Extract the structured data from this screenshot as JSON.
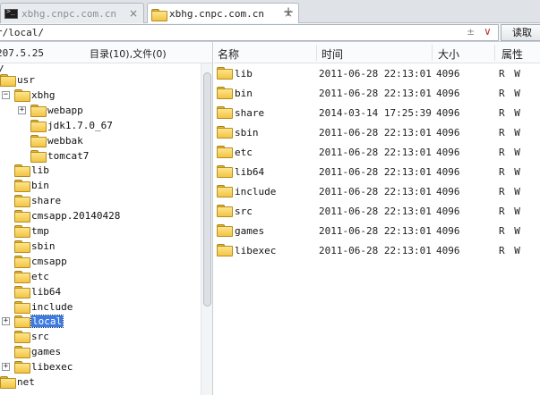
{
  "tabs": [
    {
      "label": "xbhg.cnpc.com.cn",
      "icon": "terminal-icon",
      "active": false
    },
    {
      "label": "xbhg.cnpc.com.cn",
      "icon": "folder-icon",
      "active": true
    }
  ],
  "tab_close": "×",
  "new_tab": "+",
  "path": {
    "value": "r/local/",
    "tool_glyph": "±",
    "dropdown_glyph": "∨",
    "read_label": "读取"
  },
  "left": {
    "date_fragment": "207.5.25",
    "summary": "目录(10),文件(0)",
    "root": "/",
    "tree": [
      {
        "label": "usr",
        "expander": ""
      },
      {
        "label": "xbhg",
        "expander": "−"
      },
      {
        "label": "webapp",
        "expander": "+"
      },
      {
        "label": "jdk1.7.0_67",
        "expander": ""
      },
      {
        "label": "webbak",
        "expander": ""
      },
      {
        "label": "tomcat7",
        "expander": ""
      },
      {
        "label": "lib",
        "expander": ""
      },
      {
        "label": "bin",
        "expander": ""
      },
      {
        "label": "share",
        "expander": ""
      },
      {
        "label": "cmsapp.20140428",
        "expander": ""
      },
      {
        "label": "tmp",
        "expander": ""
      },
      {
        "label": "sbin",
        "expander": ""
      },
      {
        "label": "cmsapp",
        "expander": ""
      },
      {
        "label": "etc",
        "expander": ""
      },
      {
        "label": "lib64",
        "expander": ""
      },
      {
        "label": "include",
        "expander": ""
      },
      {
        "label": "local",
        "expander": "+",
        "selected": true
      },
      {
        "label": "src",
        "expander": ""
      },
      {
        "label": "games",
        "expander": ""
      },
      {
        "label": "libexec",
        "expander": "+"
      },
      {
        "label": "net",
        "expander": ""
      }
    ]
  },
  "right": {
    "columns": {
      "name": "名称",
      "time": "时间",
      "size": "大小",
      "attr": "属性"
    },
    "files": [
      {
        "name": "lib",
        "time": "2011-06-28 22:13:01",
        "size": "4096",
        "attr": "R W"
      },
      {
        "name": "bin",
        "time": "2011-06-28 22:13:01",
        "size": "4096",
        "attr": "R W"
      },
      {
        "name": "share",
        "time": "2014-03-14 17:25:39",
        "size": "4096",
        "attr": "R W"
      },
      {
        "name": "sbin",
        "time": "2011-06-28 22:13:01",
        "size": "4096",
        "attr": "R W"
      },
      {
        "name": "etc",
        "time": "2011-06-28 22:13:01",
        "size": "4096",
        "attr": "R W"
      },
      {
        "name": "lib64",
        "time": "2011-06-28 22:13:01",
        "size": "4096",
        "attr": "R W"
      },
      {
        "name": "include",
        "time": "2011-06-28 22:13:01",
        "size": "4096",
        "attr": "R W"
      },
      {
        "name": "src",
        "time": "2011-06-28 22:13:01",
        "size": "4096",
        "attr": "R W"
      },
      {
        "name": "games",
        "time": "2011-06-28 22:13:01",
        "size": "4096",
        "attr": "R W"
      },
      {
        "name": "libexec",
        "time": "2011-06-28 22:13:01",
        "size": "4096",
        "attr": "R W"
      }
    ]
  }
}
